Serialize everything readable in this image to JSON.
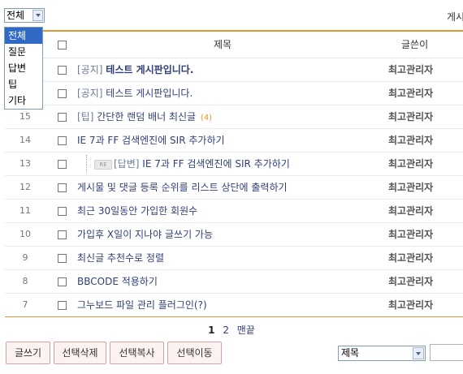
{
  "category": {
    "selected": "전체",
    "options": [
      "전체",
      "질문",
      "답변",
      "팁",
      "기타"
    ]
  },
  "top_right_label": "게시",
  "table": {
    "headers": {
      "subject": "제목",
      "author": "글쓴이"
    },
    "rows": [
      {
        "num": "",
        "prefix": "[공지]",
        "title": "테스트 게시판입니다.",
        "bold": true,
        "author": "최고관리자"
      },
      {
        "num": "",
        "prefix": "[공지]",
        "title": "테스트 게시판입니다.",
        "bold": false,
        "author": "최고관리자"
      },
      {
        "num": "15",
        "prefix": "[팁]",
        "title": "간단한 랜덤 배너 최신글",
        "comments": "(4)",
        "author": "최고관리자"
      },
      {
        "num": "14",
        "prefix": "",
        "title": "IE 7과 FF 검색엔진에 SIR 추가하기",
        "author": "최고관리자"
      },
      {
        "num": "13",
        "prefix": "[답변]",
        "title": "IE 7과 FF 검색엔진에 SIR 추가하기",
        "reply": true,
        "reply_badge": "RE",
        "author": "최고관리자"
      },
      {
        "num": "12",
        "prefix": "",
        "title": "게시물 및 댓글 등록 순위를 리스트 상단에 출력하기",
        "author": "최고관리자"
      },
      {
        "num": "11",
        "prefix": "",
        "title": "최근 30일동안 가입한 회원수",
        "author": "최고관리자"
      },
      {
        "num": "10",
        "prefix": "",
        "title": "가입후 X일이 지나야 글쓰기 가능",
        "author": "최고관리자"
      },
      {
        "num": "9",
        "prefix": "",
        "title": "최신글 추천수로 정렬",
        "author": "최고관리자"
      },
      {
        "num": "8",
        "prefix": "",
        "title": "BBCODE 적용하기",
        "author": "최고관리자"
      },
      {
        "num": "7",
        "prefix": "",
        "title": "그누보드 파일 관리 플러그인(?)",
        "author": "최고관리자"
      }
    ]
  },
  "paging": {
    "current": "1",
    "next": "2",
    "last": "맨끝"
  },
  "buttons": {
    "write": "글쓰기",
    "delete": "선택삭제",
    "copy": "선택복사",
    "move": "선택이동"
  },
  "search": {
    "field": "제목",
    "query": ""
  }
}
